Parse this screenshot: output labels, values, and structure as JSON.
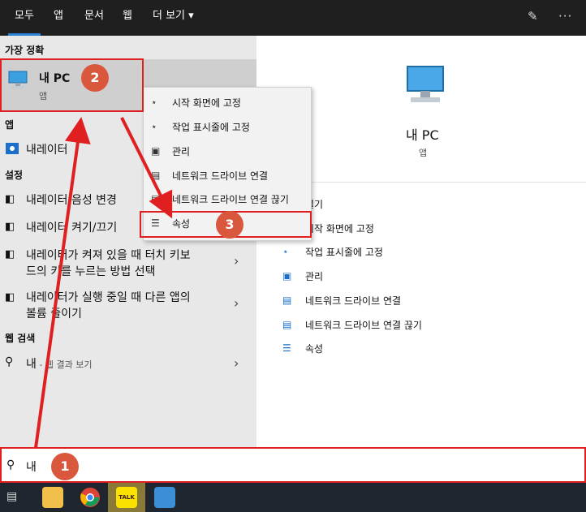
{
  "top_tabs": [
    {
      "label": "모두",
      "active": true
    },
    {
      "label": "앱"
    },
    {
      "label": "문서"
    },
    {
      "label": "웹"
    },
    {
      "label": "더 보기 ▾"
    }
  ],
  "top_icons": [
    "feedback-icon",
    "more-options-icon"
  ],
  "left": {
    "best_match_header": "가장 정확",
    "best_match": {
      "title": "내 PC",
      "subtitle": "앱"
    },
    "apps_header": "앱",
    "apps_item": "내레이터",
    "settings_header": "설정",
    "settings_items": [
      "내레이터 음성 변경",
      "내레이터 켜기/끄기",
      "내레이터가 켜져 있을 때 터치 키보",
      "드의 키를 누르는 방법 선택",
      "내레이터가 실행 중일 때 다른 앱의",
      "볼륨 줄이기"
    ],
    "web_header": "웹 검색",
    "web_item": "내",
    "web_item_suffix": " - 웹 결과 보기"
  },
  "context_menu": [
    "시작 화면에 고정",
    "작업 표시줄에 고정",
    "관리",
    "네트워크 드라이브 연결",
    "네트워크 드라이브 연결 끊기",
    "속성"
  ],
  "right": {
    "title": "내 PC",
    "subtitle": "앱",
    "actions": [
      "열기",
      "시작 화면에 고정",
      "작업 표시줄에 고정",
      "관리",
      "네트워크 드라이브 연결",
      "네트워크 드라이브 연결 끊기",
      "속성"
    ]
  },
  "search": {
    "value": "내"
  },
  "badges": [
    "1",
    "2",
    "3"
  ],
  "taskbar_icons": [
    "task-view-icon",
    "file-explorer-icon",
    "chrome-icon",
    "kakaotalk-icon",
    "app-icon"
  ],
  "kakao_label": "TALK",
  "colors": {
    "accent": "#2a7fd4",
    "highlight": "#e02020",
    "badge": "#d9573d"
  }
}
